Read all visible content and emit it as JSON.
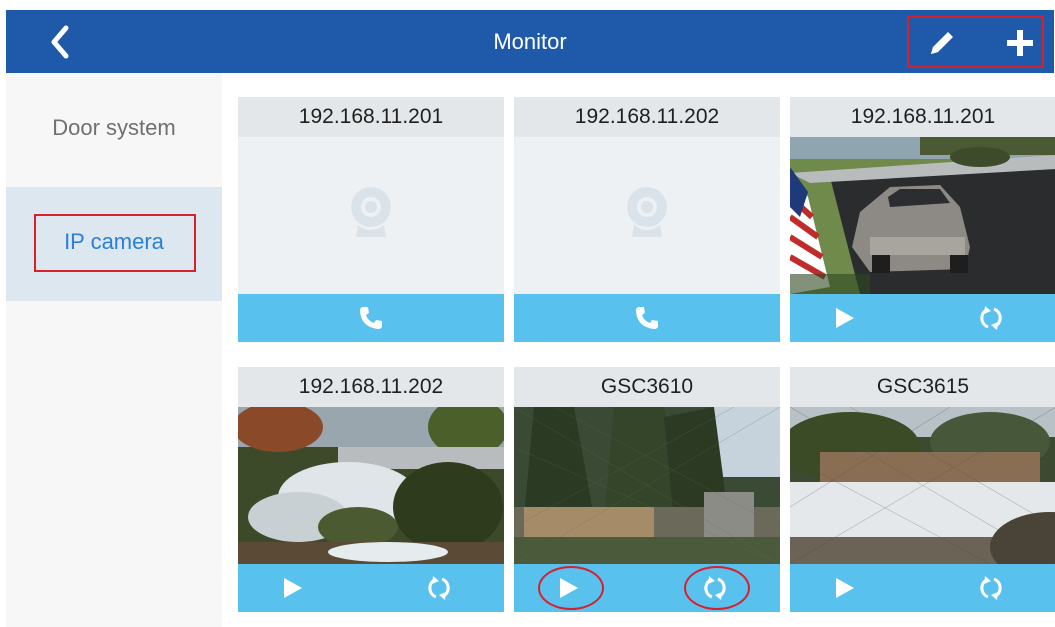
{
  "header": {
    "title": "Monitor",
    "back_icon": "chevron-left-icon",
    "edit_icon": "pencil-icon",
    "add_icon": "plus-icon",
    "background": "#1f5aaa"
  },
  "sidebar": {
    "items": [
      {
        "label": "Door system",
        "selected": false
      },
      {
        "label": "IP camera",
        "selected": true
      }
    ]
  },
  "cameras": [
    {
      "title": "192.168.11.201",
      "feed": "empty",
      "actions": [
        "phone-icon"
      ]
    },
    {
      "title": "192.168.11.202",
      "feed": "empty",
      "actions": [
        "phone-icon"
      ]
    },
    {
      "title": "192.168.11.201",
      "feed": "driveway",
      "actions": [
        "play-icon",
        "refresh-icon"
      ]
    },
    {
      "title": "192.168.11.202",
      "feed": "snowy-yard",
      "actions": [
        "play-icon",
        "refresh-icon"
      ]
    },
    {
      "title": "GSC3610",
      "feed": "fence-trees",
      "actions": [
        "play-icon",
        "refresh-icon"
      ]
    },
    {
      "title": "GSC3615",
      "feed": "snowy-fence",
      "actions": [
        "play-icon",
        "refresh-icon"
      ]
    }
  ],
  "colors": {
    "accent": "#58c1ee",
    "highlight": "#d6202a",
    "selected_text": "#2b7fd9"
  }
}
